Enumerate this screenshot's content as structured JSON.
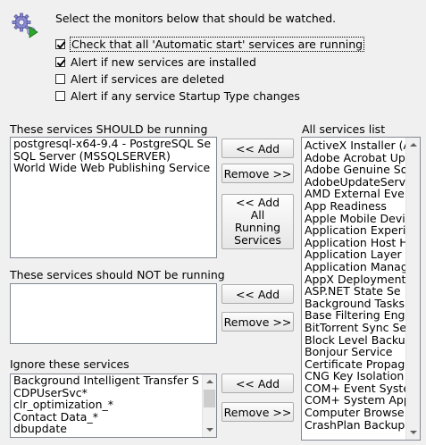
{
  "header": {
    "icon": "gear-icon",
    "instruction": "Select the monitors below that should be watched."
  },
  "options": [
    {
      "label": "Check that all 'Automatic start' services are running",
      "checked": true
    },
    {
      "label": "Alert if new services are installed",
      "checked": true
    },
    {
      "label": "Alert if services are deleted",
      "checked": false
    },
    {
      "label": "Alert if any service Startup Type changes",
      "checked": false
    }
  ],
  "should_run": {
    "title": "These services SHOULD be running",
    "items": [
      "postgresql-x64-9.4 - PostgreSQL Se",
      "SQL Server (MSSQLSERVER)",
      "World Wide Web Publishing Service"
    ],
    "add_label": "<< Add",
    "remove_label": "Remove >>",
    "add_all_label": "<< Add All Running Services"
  },
  "should_not_run": {
    "title": "These services should NOT be running",
    "items": [],
    "add_label": "<< Add",
    "remove_label": "Remove >>"
  },
  "ignore": {
    "title": "Ignore these services",
    "items": [
      "Background Intelligent Transfer S",
      "CDPUserSvc*",
      "clr_optimization_*",
      "Contact Data_*",
      "dbupdate"
    ],
    "add_label": "<< Add",
    "remove_label": "Remove >>"
  },
  "all_services": {
    "title": "All services list",
    "items": [
      "ActiveX Installer (A",
      "Adobe Acrobat Up",
      "Adobe Genuine So",
      "AdobeUpdateServ",
      "AMD External Eve",
      "App Readiness",
      "Apple Mobile Devi",
      "Application Experi",
      "Application Host H",
      "Application Layer",
      "Application Manag",
      "AppX Deployment",
      "ASP.NET State Se",
      "Background Tasks",
      "Base Filtering Eng",
      "BitTorrent Sync Se",
      "Block Level Backu",
      "Bonjour Service",
      "Certificate Propag",
      "CNG Key Isolation",
      "COM+ Event Syste",
      "COM+ System App",
      "Computer Browse",
      "CrashPlan Backup"
    ]
  }
}
